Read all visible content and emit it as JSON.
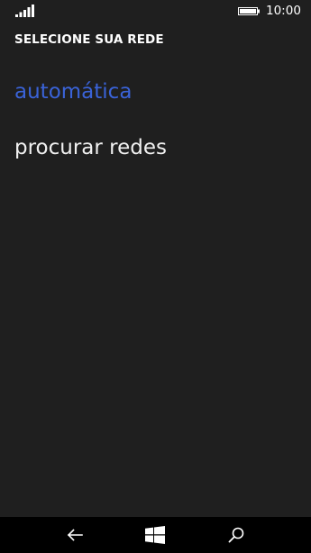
{
  "status_bar": {
    "time": "10:00",
    "signal_icon": "signal-bars-icon",
    "battery_icon": "battery-full-icon"
  },
  "page": {
    "title": "SELECIONE SUA REDE"
  },
  "options": [
    {
      "label": "automática",
      "selected": true
    },
    {
      "label": "procurar redes",
      "selected": false
    }
  ],
  "nav_bar": {
    "back_icon": "back-arrow-icon",
    "home_icon": "windows-logo-icon",
    "search_icon": "search-icon"
  },
  "colors": {
    "background": "#1f1f1f",
    "accent": "#3a63d8",
    "text": "#ffffff",
    "nav_background": "#000000"
  }
}
